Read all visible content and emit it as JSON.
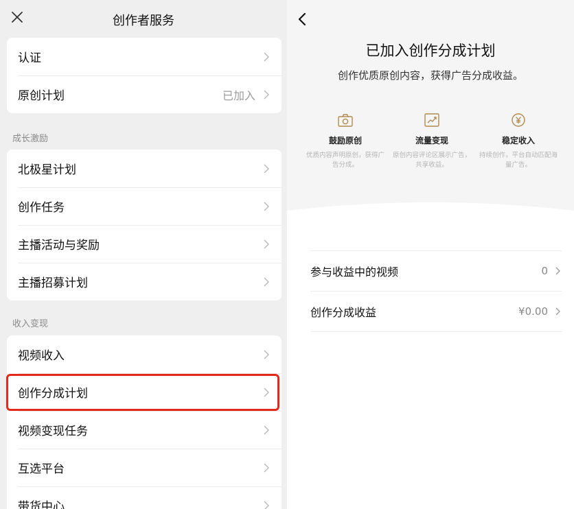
{
  "left": {
    "title": "创作者服务",
    "top_items": [
      {
        "label": "认证",
        "value": ""
      },
      {
        "label": "原创计划",
        "value": "已加入"
      }
    ],
    "sections": [
      {
        "title": "成长激励",
        "items": [
          {
            "label": "北极星计划"
          },
          {
            "label": "创作任务"
          },
          {
            "label": "主播活动与奖励"
          },
          {
            "label": "主播招募计划"
          }
        ]
      },
      {
        "title": "收入变现",
        "items": [
          {
            "label": "视频收入"
          },
          {
            "label": "创作分成计划"
          },
          {
            "label": "视频变现任务"
          },
          {
            "label": "互选平台"
          },
          {
            "label": "带货中心"
          }
        ]
      }
    ]
  },
  "right": {
    "title": "已加入创作分成计划",
    "subtitle": "创作优质原创内容，获得广告分成收益。",
    "features": [
      {
        "icon": "camera-icon",
        "title": "鼓励原创",
        "desc": "优质内容声明原创，获得广告分成。"
      },
      {
        "icon": "trend-chart-icon",
        "title": "流量变现",
        "desc": "原创内容评论区展示广告，共享收益。"
      },
      {
        "icon": "yen-coin-icon",
        "title": "稳定收入",
        "desc": "持续创作，平台自动匹配海量广告。"
      }
    ],
    "rows": [
      {
        "label": "参与收益中的视频",
        "value": "0"
      },
      {
        "label": "创作分成收益",
        "value": "¥0.00"
      }
    ]
  },
  "colors": {
    "highlight": "#e6281c",
    "background": "#efefef",
    "card": "#ffffff"
  }
}
